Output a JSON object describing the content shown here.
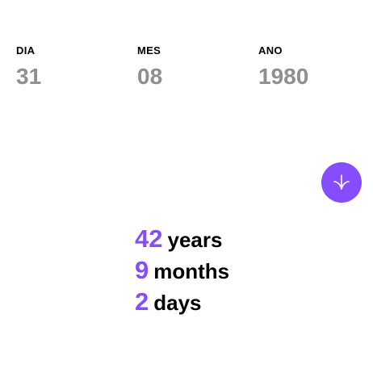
{
  "inputs": {
    "day": {
      "label": "DIA",
      "value": "31"
    },
    "month": {
      "label": "MES",
      "value": "08"
    },
    "year": {
      "label": "ANO",
      "value": "1980"
    }
  },
  "submit": {
    "icon": "arrow-down-icon",
    "color": "#854dff"
  },
  "results": [
    {
      "number": "42",
      "unit": "years"
    },
    {
      "number": "9",
      "unit": "months"
    },
    {
      "number": "2",
      "unit": "days"
    }
  ],
  "colors": {
    "accent": "#854dff",
    "label": "#000000",
    "value": "#8f8f8f"
  }
}
